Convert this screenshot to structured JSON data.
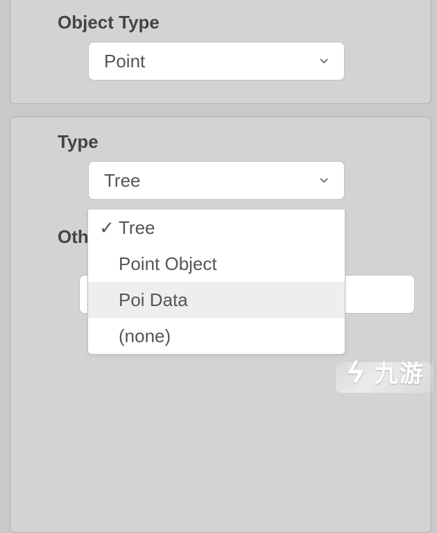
{
  "section1": {
    "label": "Object Type",
    "select_value": "Point"
  },
  "section2": {
    "label": "Type",
    "select_value": "Tree",
    "other_label": "Oth",
    "dropdown": {
      "selected_index": 0,
      "highlight_index": 2,
      "items": [
        "Tree",
        "Point Object",
        "Poi Data",
        "(none)"
      ]
    }
  },
  "watermark": {
    "brand": "九游",
    "symbol": "ϟ"
  }
}
